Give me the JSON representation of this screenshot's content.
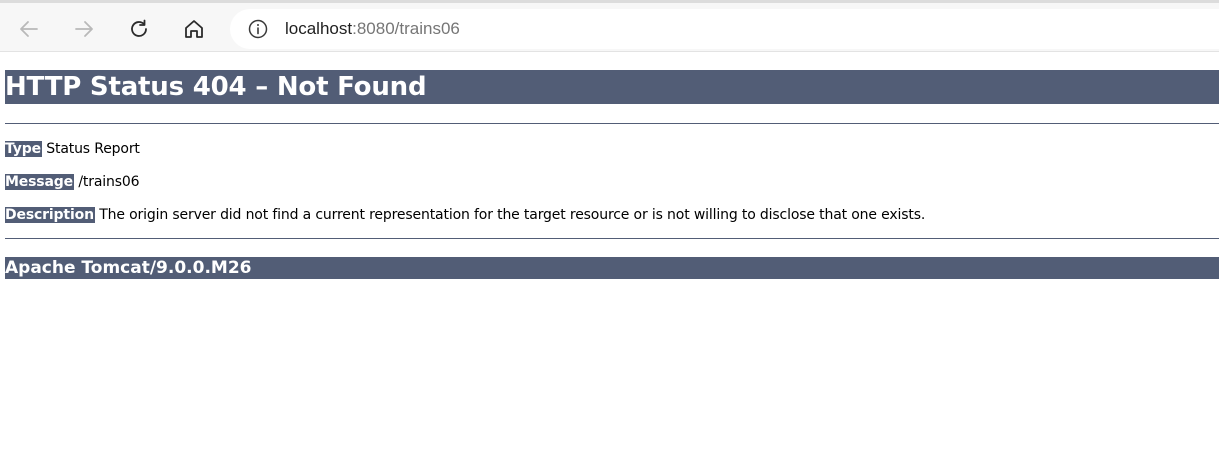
{
  "browser": {
    "url_host": "localhost",
    "url_rest": ":8080/trains06",
    "icons": {
      "back": "back-arrow-icon",
      "forward": "forward-arrow-icon",
      "reload": "reload-icon",
      "home": "home-icon",
      "info": "info-icon"
    }
  },
  "page": {
    "heading": "HTTP Status 404 – Not Found",
    "rows": [
      {
        "label": "Type",
        "value": " Status Report"
      },
      {
        "label": "Message",
        "value": " /trains06"
      },
      {
        "label": "Description",
        "value": " The origin server did not find a current representation for the target resource or is not willing to disclose that one exists."
      }
    ],
    "footer": "Apache Tomcat/9.0.0.M26"
  },
  "colors": {
    "tomcat_header": "#525d76",
    "toolbar": "#f7f7f7"
  }
}
